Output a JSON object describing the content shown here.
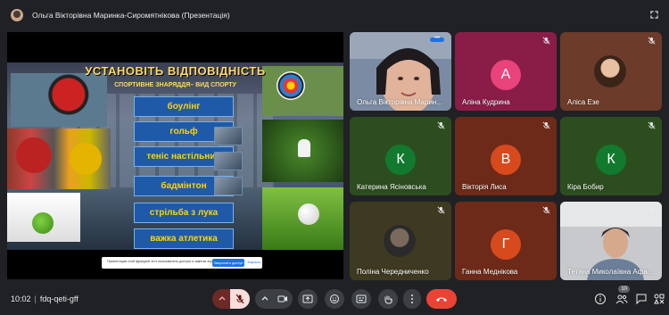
{
  "meeting": {
    "title": "Ольга Вікторівна Маринка-Сиромятнікова (Презентація)",
    "time": "10:02",
    "code": "fdq-qeti-gff",
    "participants_count": "10"
  },
  "slide": {
    "title": "УСТАНОВІТЬ ВІДПОВІДНІСТЬ",
    "subtitle": "СПОРТИВНЕ ЗНАРЯДДЯ– ВИД СПОРТУ",
    "sports": [
      "боулінг",
      "гольф",
      "теніс настільний",
      "бадмінтон",
      "стрільба з лука",
      "важка атлетика"
    ]
  },
  "notice": {
    "text": "Презентацию этой функцией этот пользователь доступа и заметки экрана",
    "primary_label": "Запросить доступ",
    "secondary_label": "Закрыть"
  },
  "participants": [
    {
      "name": "Ольга Вікторівна Марин...",
      "kind": "video",
      "bg": "#5b6a80"
    },
    {
      "name": "Аліна Кудрина",
      "kind": "letter",
      "letter": "А",
      "bg": "#8a1d47",
      "avatar_color": "#e8437a",
      "muted": true
    },
    {
      "name": "Аліса Езе",
      "kind": "photo",
      "bg": "#6d3b2a",
      "muted": true
    },
    {
      "name": "Катерина Ясіновська",
      "kind": "letter",
      "letter": "К",
      "bg": "#2c4e1f",
      "avatar_color": "#127a2e",
      "muted": true
    },
    {
      "name": "Вікторія Лиса",
      "kind": "letter",
      "letter": "В",
      "bg": "#6e2a18",
      "avatar_color": "#d64a1e",
      "muted": true
    },
    {
      "name": "Кіра Бобир",
      "kind": "letter",
      "letter": "К",
      "bg": "#2c4e1f",
      "avatar_color": "#127a2e",
      "muted": true
    },
    {
      "name": "Поліна Чередниченко",
      "kind": "photo",
      "bg": "#3e3a22",
      "muted": true
    },
    {
      "name": "Ганна Меднікова",
      "kind": "letter",
      "letter": "Г",
      "bg": "#6e2a18",
      "avatar_color": "#d64a1e",
      "muted": true
    },
    {
      "name": "Тетяна Миколаївна Афа...",
      "kind": "video",
      "bg": "#a6a9ad",
      "muted": true
    }
  ],
  "colors": {
    "background": "#202124",
    "end_call": "#ea4335",
    "mic_off_bg": "#f9dedc",
    "accent": "#1a73e8"
  },
  "controls": [
    "chevron-up-icon",
    "mic-off-icon",
    "chevron-up-icon",
    "camera-icon",
    "present-icon",
    "emoji-icon",
    "captions-icon",
    "raise-hand-icon",
    "more-icon",
    "end-call-icon"
  ]
}
